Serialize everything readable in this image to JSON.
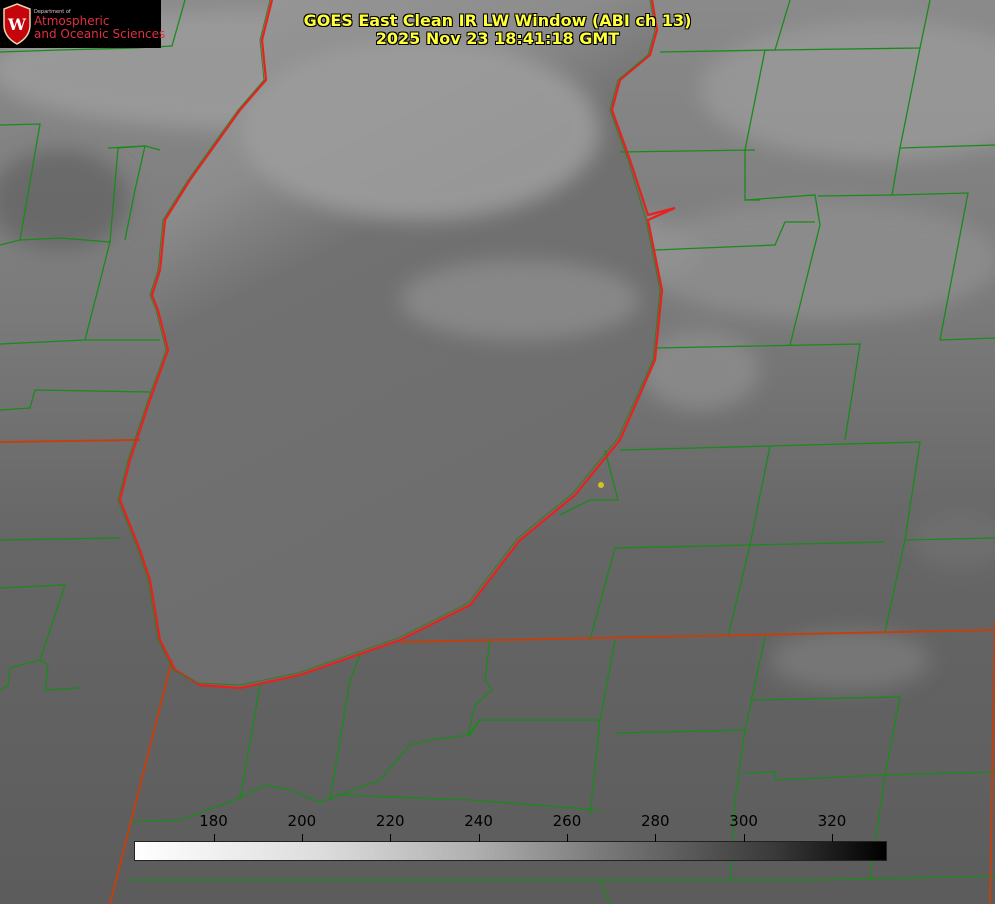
{
  "title": {
    "line1": "GOES East Clean IR LW Window (ABI ch 13)",
    "line2": "2025 Nov 23 18:41:18 GMT"
  },
  "logo": {
    "dept": "Department of",
    "line1": "Atmospheric",
    "line2": "and Oceanic Sciences",
    "emblem_letter": "W",
    "emblem_icon": "uw-crest-icon"
  },
  "colorbar": {
    "ticks": [
      "180",
      "200",
      "220",
      "240",
      "260",
      "280",
      "300",
      "320"
    ],
    "range": [
      162,
      332
    ],
    "gradient": [
      "#ffffff",
      "#000000"
    ]
  },
  "colors": {
    "title": "#ffff3a",
    "county_lines": "#1a8a1a",
    "state_lines": "#ff2020",
    "marker": "#d4c020"
  }
}
